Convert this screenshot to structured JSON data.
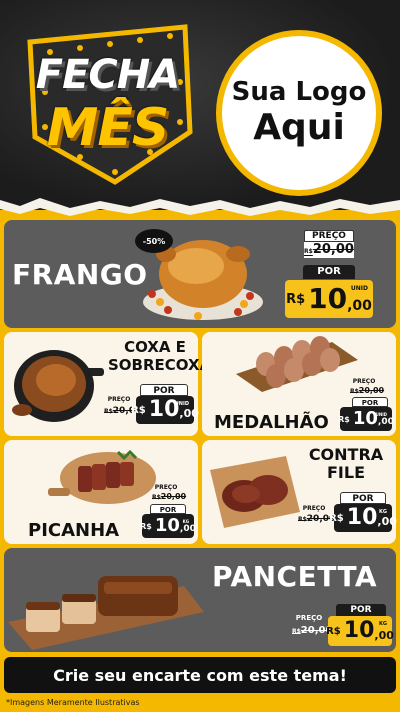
{
  "header": {
    "badge_line1": "FECHA",
    "badge_line2": "MÊS",
    "logo_line1": "Sua Logo",
    "logo_line2": "Aqui"
  },
  "discount_badge": "-50%",
  "products": {
    "frango": {
      "name": "FRANGO",
      "preco_label": "PREÇO",
      "old_currency": "R$",
      "old_price": "20,00",
      "por_label": "POR",
      "currency": "R$",
      "price_int": "10",
      "price_dec": ",00",
      "unit": "UNID"
    },
    "coxa": {
      "name_line1": "COXA E",
      "name_line2": "SOBRECOXA",
      "preco_label": "PREÇO",
      "old_currency": "R$",
      "old_price": "20,00",
      "por_label": "POR",
      "currency": "R$",
      "price_int": "10",
      "price_dec": ",00",
      "unit": "UNID"
    },
    "medalhao": {
      "name": "MEDALHÃO",
      "preco_label": "PREÇO",
      "old_currency": "R$",
      "old_price": "20,00",
      "por_label": "POR",
      "currency": "R$",
      "price_int": "10",
      "price_dec": ",00",
      "unit": "UNID"
    },
    "picanha": {
      "name": "PICANHA",
      "preco_label": "PREÇO",
      "old_currency": "R$",
      "old_price": "20,00",
      "por_label": "POR",
      "currency": "R$",
      "price_int": "10",
      "price_dec": ",00",
      "unit": "KG"
    },
    "contrafile": {
      "name_line1": "CONTRA",
      "name_line2": "FILE",
      "preco_label": "PREÇO",
      "old_currency": "R$",
      "old_price": "20,00",
      "por_label": "POR",
      "currency": "R$",
      "price_int": "10",
      "price_dec": ",00",
      "unit": "KG"
    },
    "pancetta": {
      "name": "PANCETTA",
      "preco_label": "PREÇO",
      "old_currency": "R$",
      "old_price": "20,00",
      "por_label": "POR",
      "currency": "R$",
      "price_int": "10",
      "price_dec": ",00",
      "unit": "KG"
    }
  },
  "cta": "Crie seu encarte com este tema!",
  "disclaimer": "*Imagens Meramente Ilustrativas",
  "colors": {
    "brand_yellow": "#f5b800",
    "dark": "#1b1b1b",
    "panel_gray": "#5c5c5c",
    "panel_cream": "#fbf4e8"
  }
}
